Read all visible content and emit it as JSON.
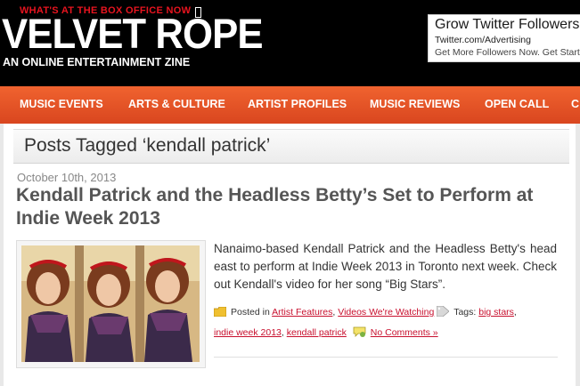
{
  "header": {
    "tagline": "WHAT'S AT THE BOX OFFICE NOW",
    "logo": "VELVET ROPE",
    "subtitle": "AN ONLINE ENTERTAINMENT ZINE"
  },
  "ad": {
    "title": "Grow Twitter Followers",
    "url": "Twitter.com/Advertising",
    "text": "Get More Followers Now. Get Started Today"
  },
  "nav": {
    "items": [
      "MUSIC EVENTS",
      "ARTS & CULTURE",
      "ARTIST PROFILES",
      "MUSIC REVIEWS",
      "OPEN CALL",
      "C"
    ]
  },
  "archive": {
    "title": "Posts Tagged ‘kendall patrick’"
  },
  "post": {
    "date": "October 10th, 2013",
    "title": "Kendall Patrick and the Headless Betty’s Set to Perform at Indie Week 2013",
    "excerpt": "Nanaimo-based Kendall Patrick and the Headless Betty's head east to perform at Indie Week 2013 in Toronto next week. Check out Kendall's video for her song “Big Stars”.",
    "posted_in_label": "Posted in",
    "categories": [
      "Artist Features",
      "Videos We're Watching"
    ],
    "tags_label": "Tags:",
    "tags": [
      "big stars",
      "indie week 2013",
      "kendall patrick"
    ],
    "comments": "No Comments »"
  },
  "icons": {
    "category": "folder-icon",
    "tags": "tag-icon",
    "comments": "comment-bubble-icon"
  },
  "colors": {
    "nav": "#e8562a",
    "link": "#c8102e",
    "tagline": "#e8141f"
  }
}
